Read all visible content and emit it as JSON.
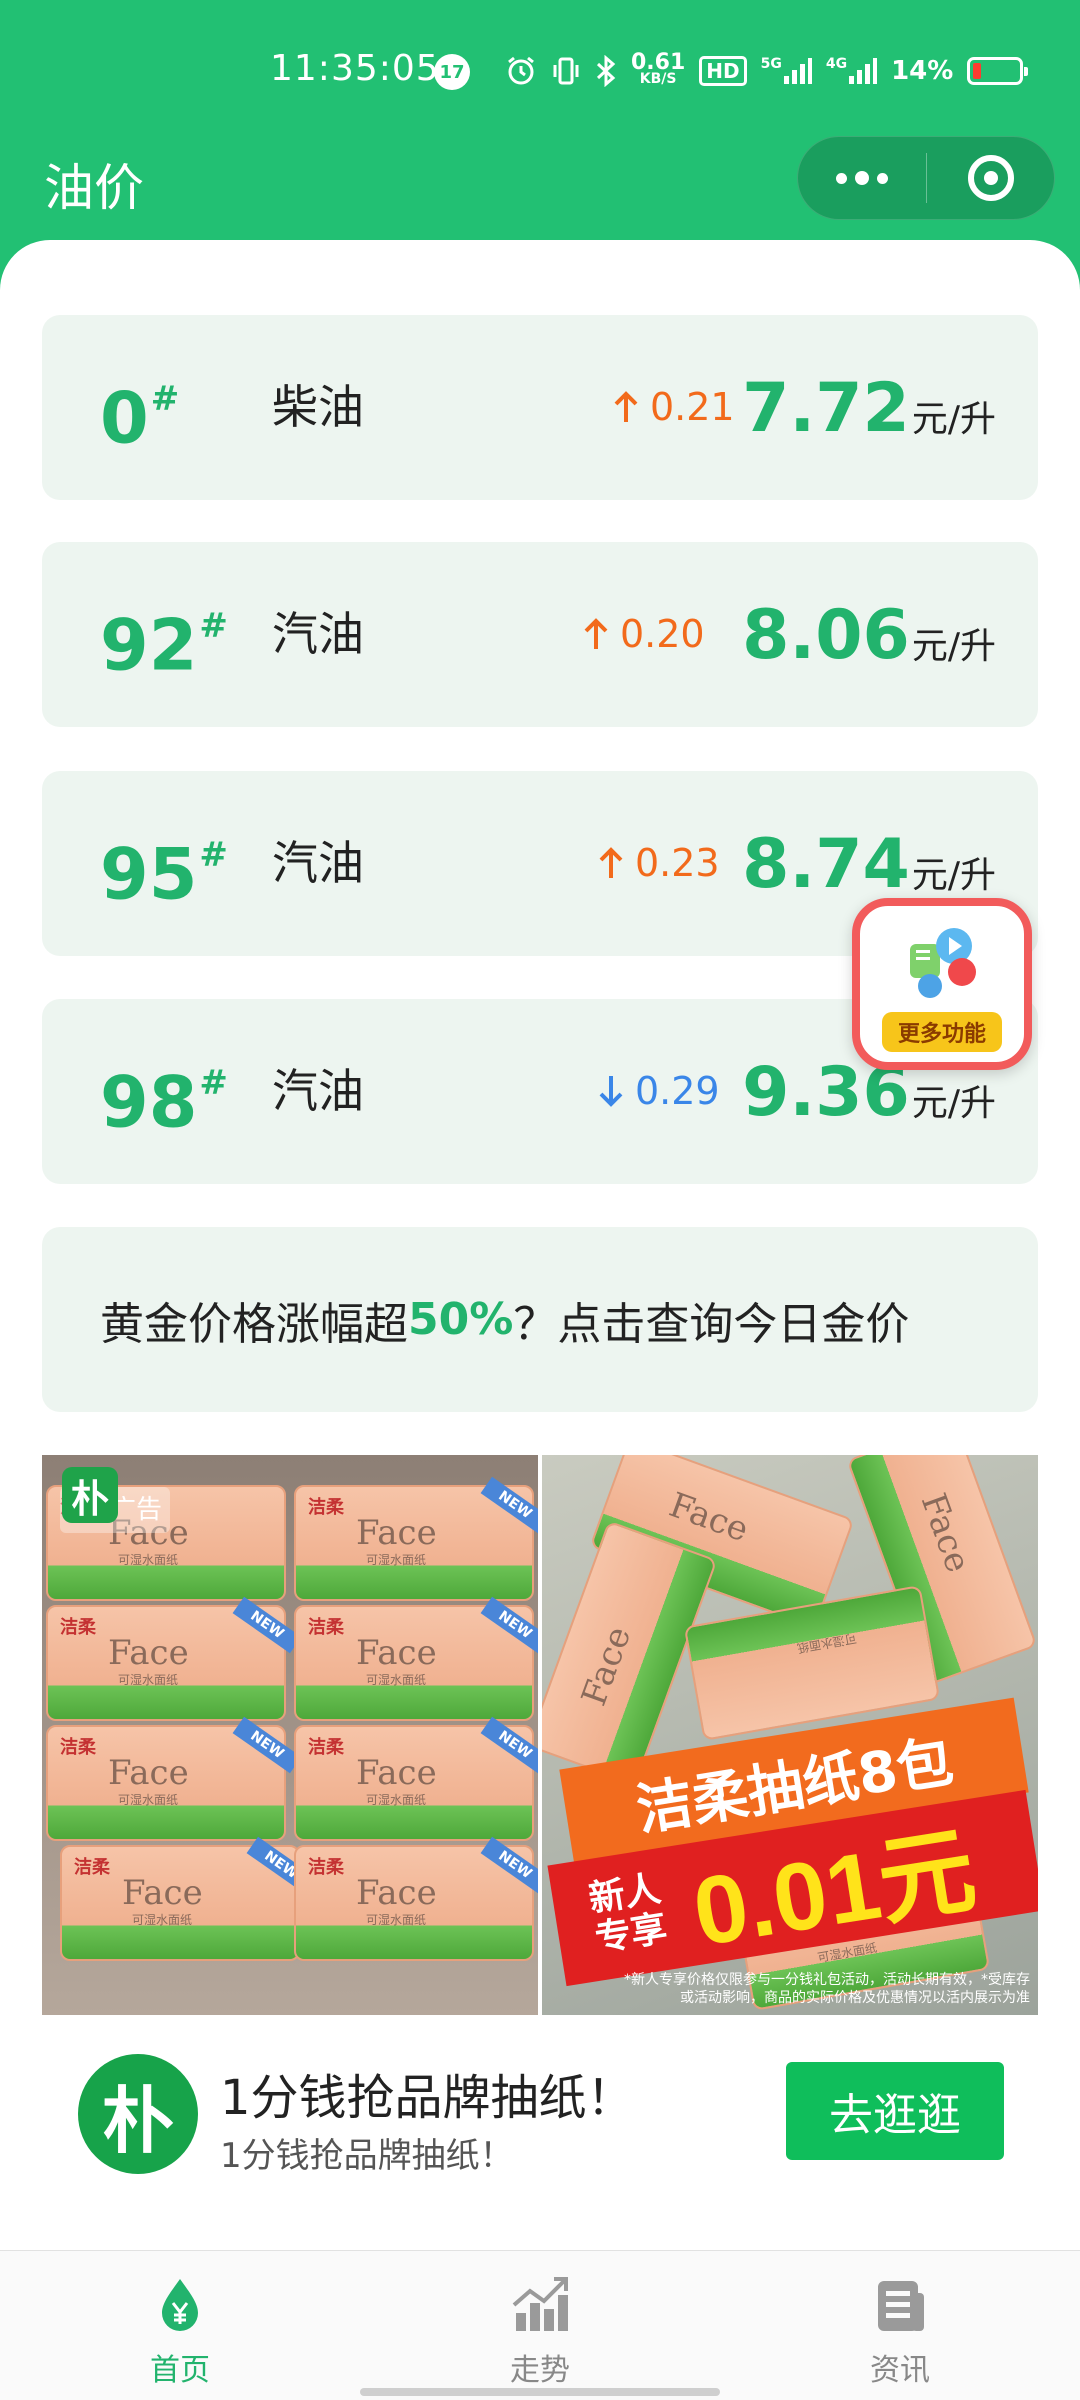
{
  "status_bar": {
    "time": "11:35:05",
    "notification_count": "17",
    "net_speed_value": "0.61",
    "net_speed_unit": "KB/S",
    "hd_label": "HD",
    "signal1": "5G",
    "signal2": "4G",
    "battery_pct": "14%"
  },
  "header": {
    "title": "油价"
  },
  "prices": [
    {
      "grade": "0",
      "fuel": "柴油",
      "direction": "up",
      "change": "0.21",
      "price": "7.72",
      "unit": "元/升"
    },
    {
      "grade": "92",
      "fuel": "汽油",
      "direction": "up",
      "change": "0.20",
      "price": "8.06",
      "unit": "元/升"
    },
    {
      "grade": "95",
      "fuel": "汽油",
      "direction": "up",
      "change": "0.23",
      "price": "8.74",
      "unit": "元/升"
    },
    {
      "grade": "98",
      "fuel": "汽油",
      "direction": "down",
      "change": "0.29",
      "price": "9.36",
      "unit": "元/升"
    }
  ],
  "grade_mark": "#",
  "gold_banner": {
    "prefix": "黄金价格涨幅超",
    "pct": "50%",
    "suffix": "？点击查询今日金价"
  },
  "float_button": {
    "label": "更多功能"
  },
  "ad": {
    "tag": "广告",
    "logo_char": "朴",
    "pack_brand": "洁柔",
    "pack_face": "Face",
    "pack_sub": "可湿水面纸",
    "pack_new": "NEW",
    "promo_line1": "洁柔抽纸8包",
    "promo_newbie": "新人专享",
    "promo_price": "0.01元",
    "promo_fine": "*新人专享价格仅限参与一分钱礼包活动，活动长期有效，*受库存或活动影响，商品的实际价格及优惠情况以活内展示为准",
    "title": "1分钱抢品牌抽纸！",
    "subtitle": "1分钱抢品牌抽纸！",
    "cta": "去逛逛"
  },
  "tabs": [
    {
      "label": "首页",
      "icon": "drop-yen-icon",
      "active": true
    },
    {
      "label": "走势",
      "icon": "trend-chart-icon",
      "active": false
    },
    {
      "label": "资讯",
      "icon": "news-icon",
      "active": false
    }
  ],
  "colors": {
    "brand_green": "#22c073",
    "price_green": "#22b36d",
    "up_orange": "#f26a1b",
    "down_blue": "#3a86e8"
  }
}
